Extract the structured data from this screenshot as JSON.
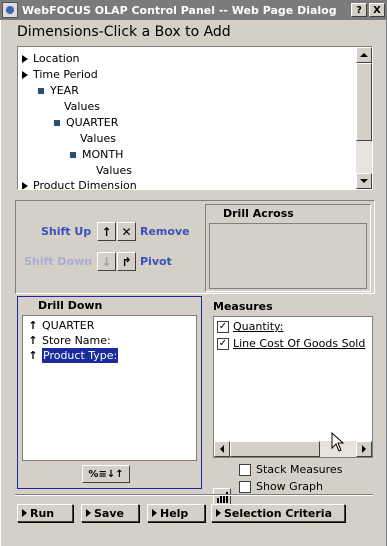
{
  "window": {
    "title": "WebFOCUS OLAP Control Panel -- Web Page Dialog",
    "help_label": "?",
    "close_label": "X"
  },
  "dimensions": {
    "heading": "Dimensions-Click a Box to Add",
    "tree": [
      {
        "label": "Location"
      },
      {
        "label": "Time Period"
      },
      {
        "label": "YEAR"
      },
      {
        "label": "Values"
      },
      {
        "label": "QUARTER"
      },
      {
        "label": "Values"
      },
      {
        "label": "MONTH"
      },
      {
        "label": "Values"
      },
      {
        "label": "Product Dimension"
      }
    ]
  },
  "controls": {
    "shift_up": "Shift Up",
    "remove": "Remove",
    "shift_down": "Shift Down",
    "pivot": "Pivot"
  },
  "drill_across": {
    "heading": "Drill Across"
  },
  "drill_down": {
    "heading": "Drill Down",
    "items": [
      "QUARTER",
      "Store Name:",
      "Product Type:"
    ],
    "selected_index": 2,
    "sort_button_label": "%≡↓↑"
  },
  "measures": {
    "heading": "Measures",
    "items": [
      {
        "label": "Quantity:",
        "checked": true
      },
      {
        "label": "Line Cost Of Goods Sold",
        "checked": true
      }
    ]
  },
  "options": {
    "stack_measures": "Stack Measures",
    "show_graph": "Show Graph"
  },
  "footer": {
    "run": "Run",
    "save": "Save",
    "help": "Help",
    "selection_criteria": "Selection Criteria"
  }
}
